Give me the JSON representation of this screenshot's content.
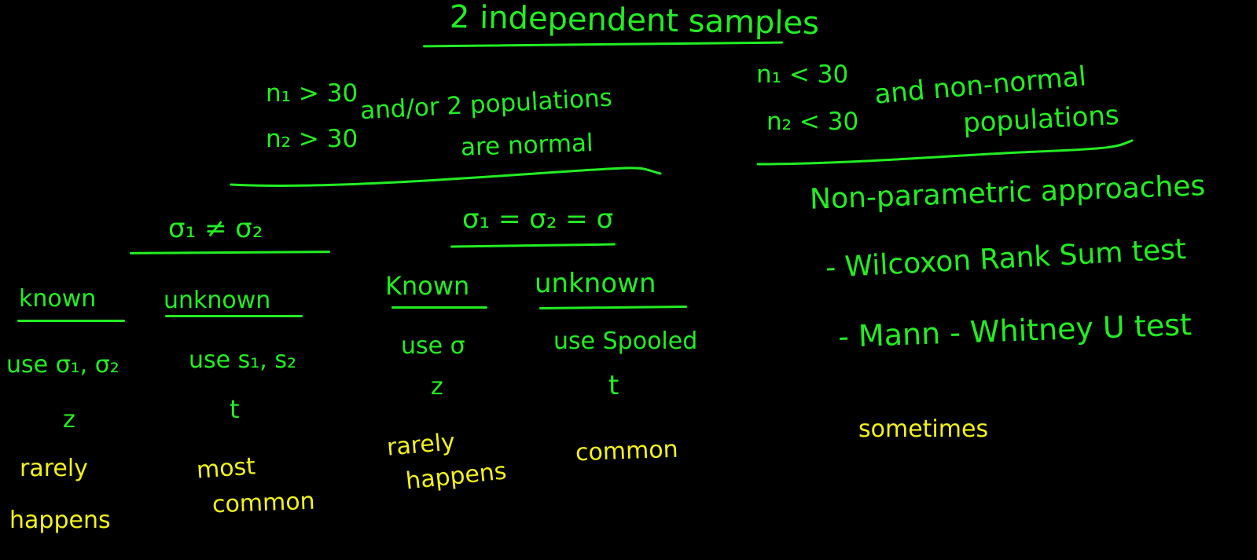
{
  "title": "2 independent samples",
  "left_branch": {
    "cond_n1": "n₁ > 30",
    "cond_n2": "n₂ > 30",
    "cond_text": "and/or 2 populations",
    "cond_text2": "are normal",
    "sigma_unequal": {
      "header": "σ₁ ≠ σ₂",
      "known": {
        "label": "known",
        "use": "use σ₁, σ₂",
        "stat": "z",
        "freq": [
          "rarely",
          "happens"
        ]
      },
      "unknown": {
        "label": "unknown",
        "use": "use s₁, s₂",
        "stat": "t",
        "freq": [
          "most",
          "common"
        ]
      }
    },
    "sigma_equal": {
      "header": "σ₁ = σ₂ = σ",
      "known": {
        "label": "Known",
        "use": "use σ",
        "stat": "z",
        "freq": [
          "rarely",
          "happens"
        ]
      },
      "unknown": {
        "label": "unknown",
        "use": "use Spooled",
        "stat": "t",
        "freq": [
          "common"
        ]
      }
    }
  },
  "right_branch": {
    "cond_n1": "n₁ < 30",
    "cond_n2": "n₂ < 30",
    "cond_text": "and non-normal",
    "cond_text2": "populations",
    "approach": "Non-parametric approaches",
    "tests": [
      "- Wilcoxon Rank Sum test",
      "- Mann - Whitney U test"
    ],
    "freq": "sometimes"
  },
  "colors": {
    "background": "#000000",
    "ink_green": "#22ee22",
    "ink_yellow": "#f2f21a"
  }
}
